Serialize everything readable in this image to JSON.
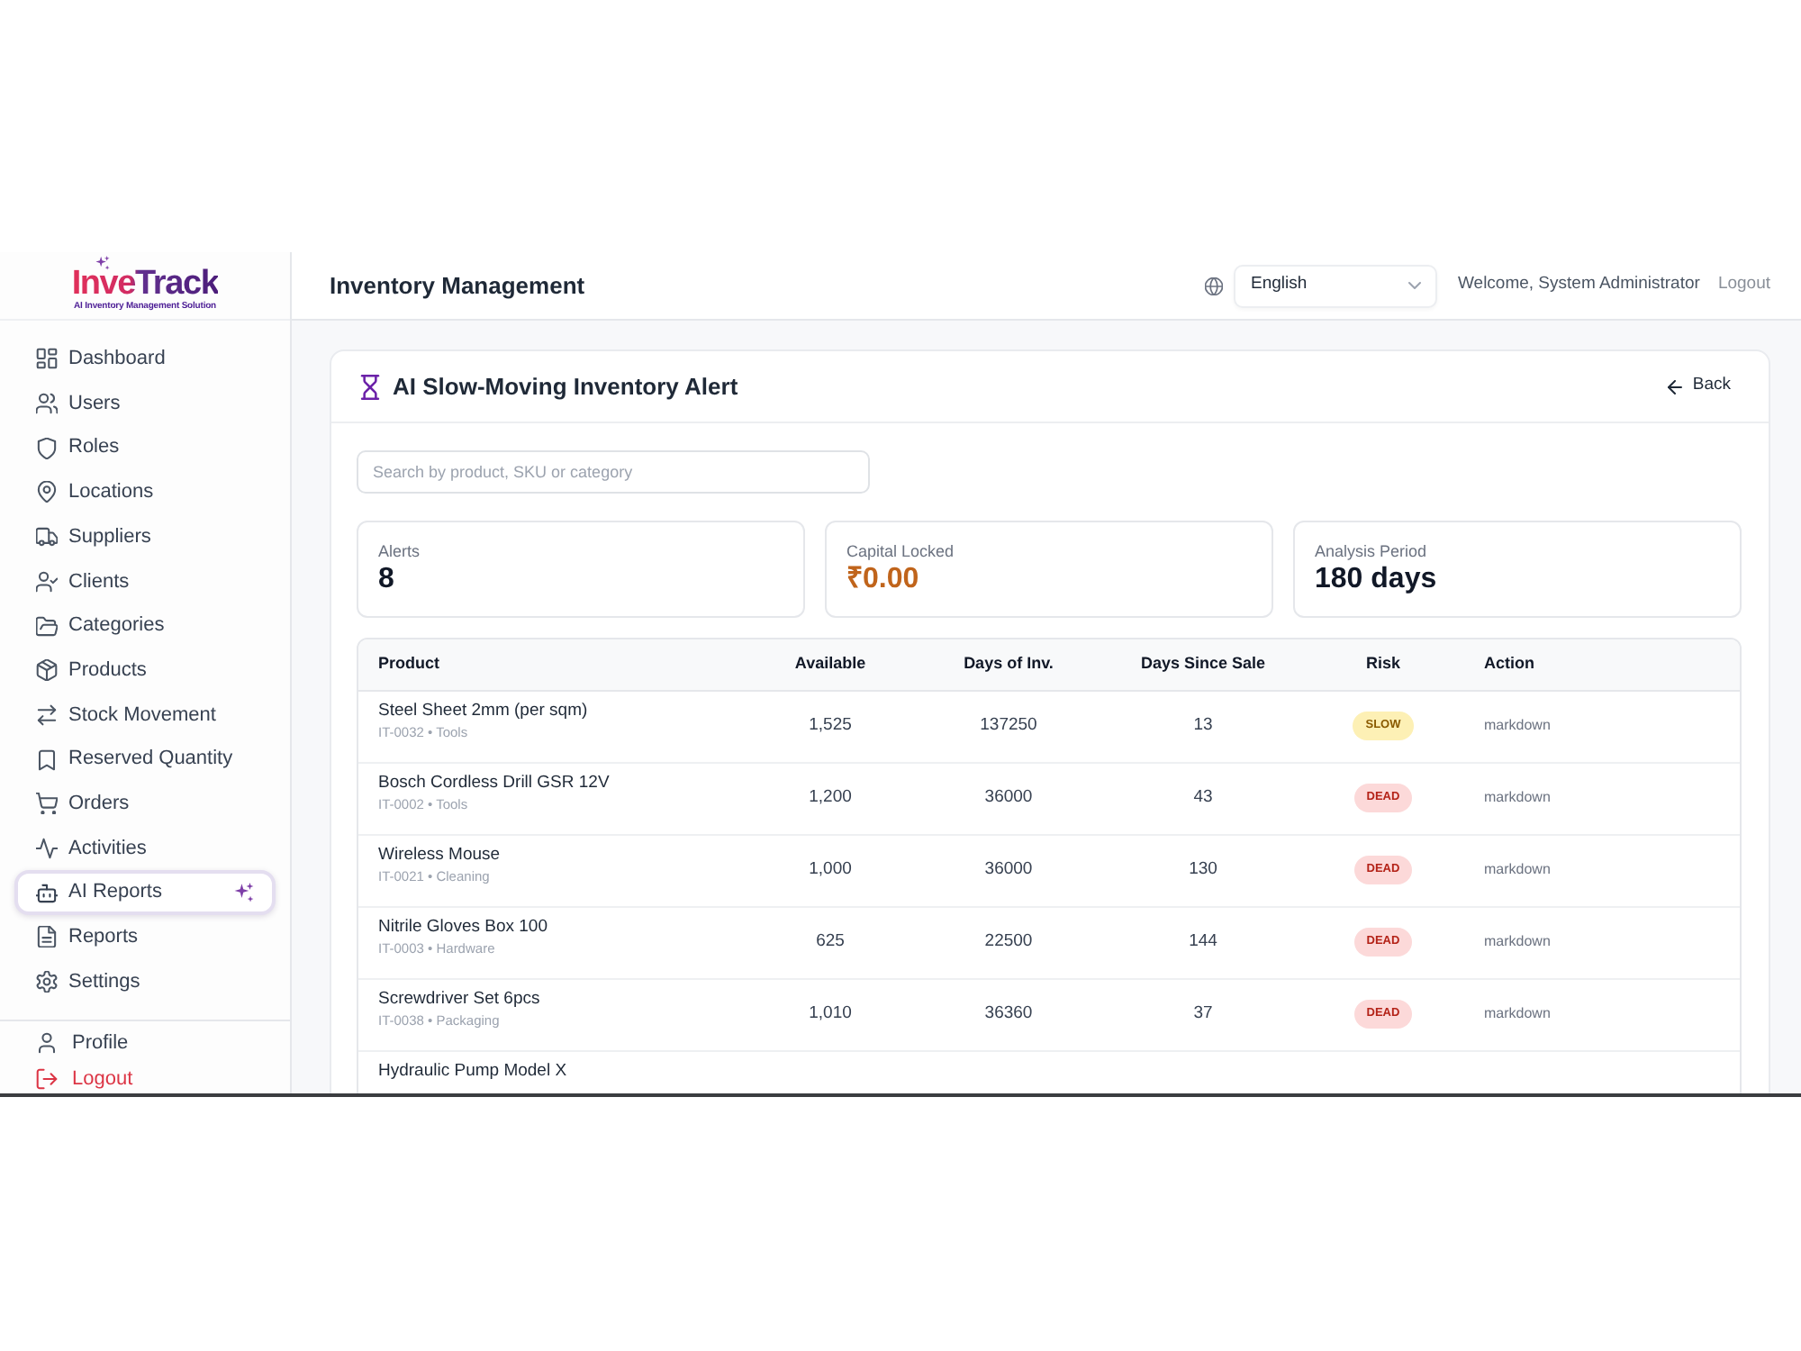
{
  "logo": {
    "name": "InveTrack",
    "tagline": "AI Inventory Management Solution"
  },
  "sidebar": {
    "items": [
      {
        "label": "Dashboard",
        "selected": false
      },
      {
        "label": "Users",
        "selected": false
      },
      {
        "label": "Roles",
        "selected": false
      },
      {
        "label": "Locations",
        "selected": false
      },
      {
        "label": "Suppliers",
        "selected": false
      },
      {
        "label": "Clients",
        "selected": false
      },
      {
        "label": "Categories",
        "selected": false
      },
      {
        "label": "Products",
        "selected": false
      },
      {
        "label": "Stock Movement",
        "selected": false
      },
      {
        "label": "Reserved Quantity",
        "selected": false
      },
      {
        "label": "Orders",
        "selected": false
      },
      {
        "label": "Activities",
        "selected": false
      },
      {
        "label": "AI Reports",
        "selected": true
      },
      {
        "label": "Reports",
        "selected": false
      },
      {
        "label": "Settings",
        "selected": false
      }
    ],
    "footer": [
      {
        "label": "Profile",
        "kind": "normal"
      },
      {
        "label": "Logout",
        "kind": "danger"
      }
    ]
  },
  "header": {
    "title": "Inventory Management",
    "language": "English",
    "welcome": "Welcome, System Administrator",
    "logout": "Logout"
  },
  "alert_card": {
    "title": "AI Slow-Moving Inventory Alert",
    "back": "Back",
    "search": {
      "placeholder": "Search by product, SKU or category"
    },
    "stats": [
      {
        "label": "Alerts",
        "value": "8",
        "kind": "plain"
      },
      {
        "label": "Capital Locked",
        "value": "₹0.00",
        "kind": "highlight"
      },
      {
        "label": "Analysis Period",
        "value": "180 days",
        "kind": "plain"
      }
    ],
    "table": {
      "columns": [
        "Product",
        "Available",
        "Days of Inv.",
        "Days Since Sale",
        "Risk",
        "Action"
      ],
      "rows": [
        {
          "product": "Steel Sheet 2mm (per sqm)",
          "meta": "IT-0032 • Tools",
          "available": "1,525",
          "days_of_inventory": "137250",
          "days_since_sale": "13",
          "risk": {
            "label": "SLOW",
            "kind": "slow"
          },
          "action": "markdown"
        },
        {
          "product": "Bosch Cordless Drill GSR 12V",
          "meta": "IT-0002 • Tools",
          "available": "1,200",
          "days_of_inventory": "36000",
          "days_since_sale": "43",
          "risk": {
            "label": "DEAD",
            "kind": "dead"
          },
          "action": "markdown"
        },
        {
          "product": "Wireless Mouse",
          "meta": "IT-0021 • Cleaning",
          "available": "1,000",
          "days_of_inventory": "36000",
          "days_since_sale": "130",
          "risk": {
            "label": "DEAD",
            "kind": "dead"
          },
          "action": "markdown"
        },
        {
          "product": "Nitrile Gloves Box 100",
          "meta": "IT-0003 • Hardware",
          "available": "625",
          "days_of_inventory": "22500",
          "days_since_sale": "144",
          "risk": {
            "label": "DEAD",
            "kind": "dead"
          },
          "action": "markdown"
        },
        {
          "product": "Screwdriver Set 6pcs",
          "meta": "IT-0038 • Packaging",
          "available": "1,010",
          "days_of_inventory": "36360",
          "days_since_sale": "37",
          "risk": {
            "label": "DEAD",
            "kind": "dead"
          },
          "action": "markdown"
        },
        {
          "product": "Hydraulic Pump Model X"
        }
      ]
    }
  }
}
